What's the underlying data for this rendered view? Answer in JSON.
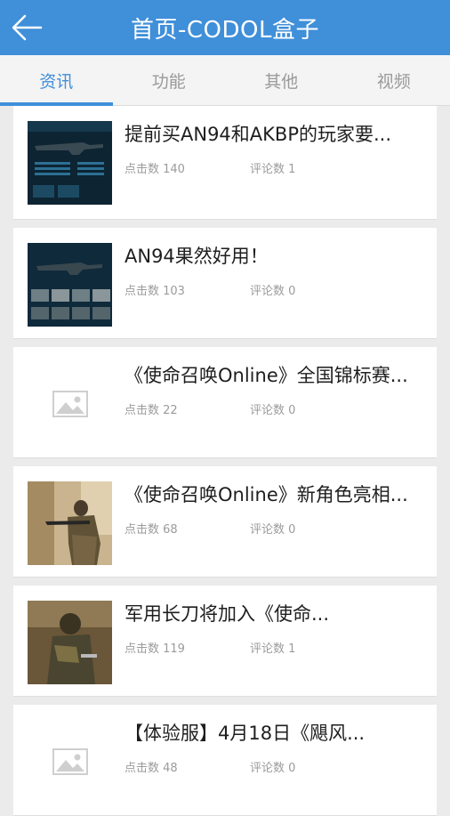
{
  "header": {
    "title": "首页-CODOL盒子"
  },
  "tabs": [
    "资讯",
    "功能",
    "其他",
    "视频"
  ],
  "articles": [
    {
      "title": "提前买AN94和AKBP的玩家要...",
      "clicks": "点击数 140",
      "comments": "评论数 1",
      "thumb": "weapon-stats-screen"
    },
    {
      "title": "AN94果然好用！",
      "clicks": "点击数 103",
      "comments": "评论数 0",
      "thumb": "weapon-inventory-screen"
    },
    {
      "title": "《使命召唤Online》全国锦标赛...",
      "clicks": "点击数 22",
      "comments": "评论数 0",
      "thumb": "placeholder"
    },
    {
      "title": "《使命召唤Online》新角色亮相...",
      "clicks": "点击数 68",
      "comments": "评论数 0",
      "thumb": "soldier-desert"
    },
    {
      "title": "军用长刀将加入《使命...",
      "clicks": "点击数 119",
      "comments": "评论数 1",
      "thumb": "soldier-knife"
    },
    {
      "title": "【体验服】4月18日《飓风...",
      "clicks": "点击数 48",
      "comments": "评论数 0",
      "thumb": "placeholder"
    }
  ],
  "colors": {
    "accent": "#3f8fd9",
    "background": "#ebebeb",
    "muted": "#9b9b9b"
  }
}
